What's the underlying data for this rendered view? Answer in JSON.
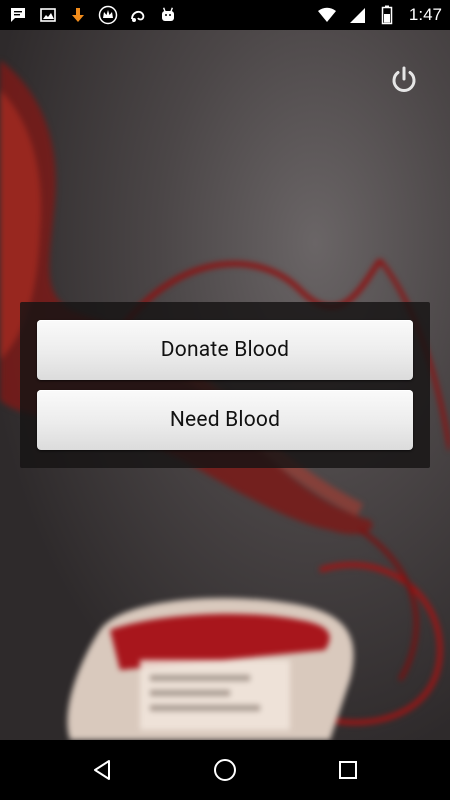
{
  "status_bar": {
    "time": "1:47",
    "left_icons": [
      "message-icon",
      "image-icon",
      "download-icon",
      "crown-app-icon",
      "uc-browser-icon",
      "android-icon"
    ],
    "right_icons": [
      "wifi-icon",
      "cellular-signal-icon",
      "battery-icon"
    ]
  },
  "main": {
    "power_icon": "power-icon",
    "buttons": {
      "donate_label": "Donate Blood",
      "need_label": "Need Blood"
    }
  },
  "nav_bar": {
    "back_icon": "back-triangle-icon",
    "home_icon": "home-circle-icon",
    "recents_icon": "recents-square-icon"
  },
  "colors": {
    "panel_bg": "#161414",
    "button_bg": "#ececec",
    "blood_red": "#b0141a",
    "status_bar_bg": "#000000"
  }
}
